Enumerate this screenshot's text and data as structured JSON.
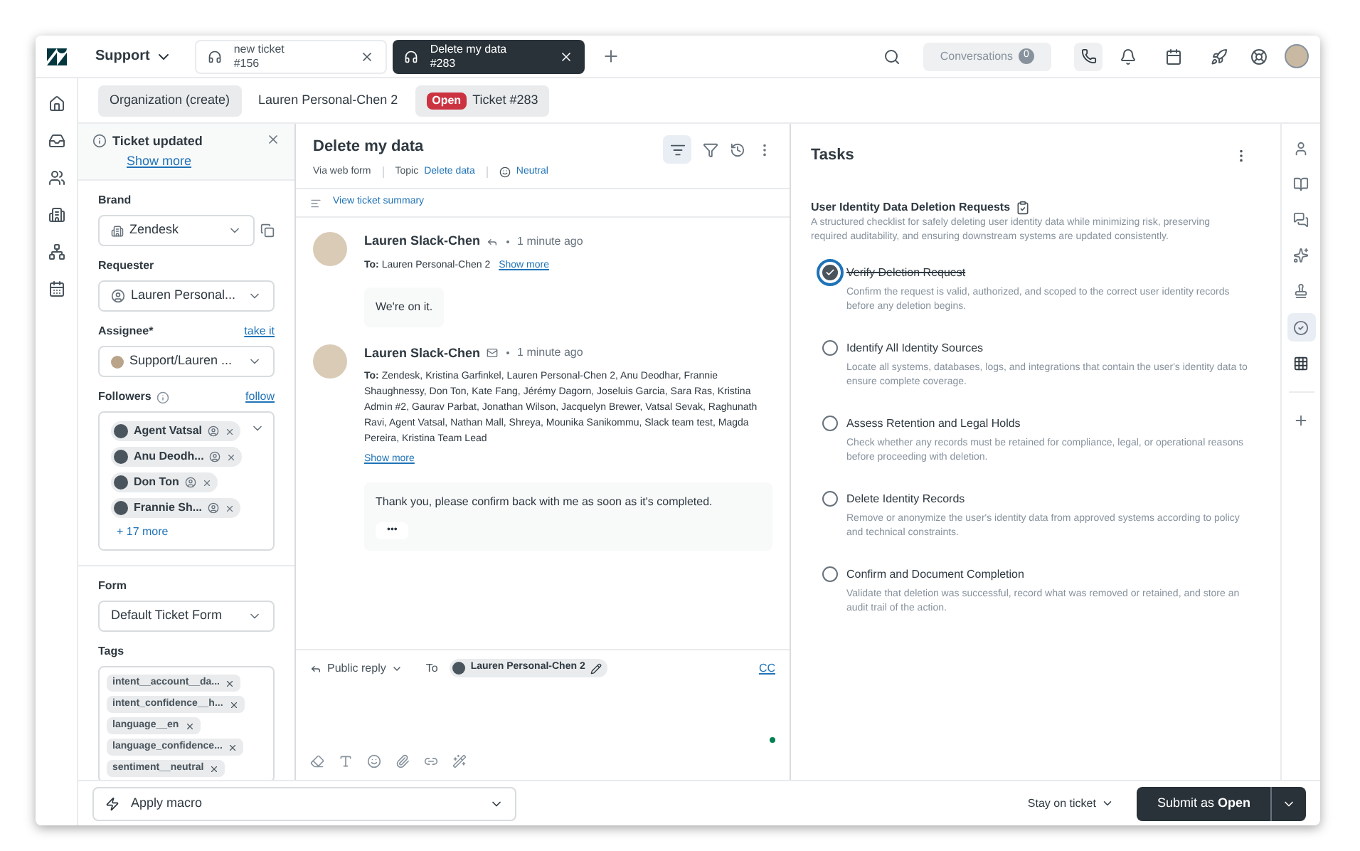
{
  "topbar": {
    "workspace": "Support",
    "tabs": [
      {
        "title": "new ticket",
        "subtitle": "#156",
        "selected": false
      },
      {
        "title": "Delete my data",
        "subtitle": "#283",
        "selected": true
      }
    ],
    "conversations": {
      "label": "Conversations",
      "count": "0"
    }
  },
  "breadcrumbs": [
    {
      "kind": "plain",
      "label": "Organization (create)",
      "selected": true
    },
    {
      "kind": "plain",
      "label": "Lauren Personal-Chen 2",
      "selected": false
    },
    {
      "kind": "status",
      "badge": "Open",
      "label": "Ticket #283",
      "selected": true
    }
  ],
  "properties": {
    "notice": {
      "title": "Ticket updated",
      "link": "Show more"
    },
    "brand": {
      "label": "Brand",
      "value": "Zendesk"
    },
    "requester": {
      "label": "Requester",
      "value": "Lauren Personal..."
    },
    "assignee": {
      "label": "Assignee*",
      "action": "take it",
      "value": "Support/Lauren ..."
    },
    "followers": {
      "label": "Followers",
      "action": "follow",
      "items": [
        "Agent Vatsal",
        "Anu Deodh...",
        "Don Ton",
        "Frannie Sh..."
      ],
      "more": "+ 17 more"
    },
    "form": {
      "label": "Form",
      "value": "Default Ticket Form"
    },
    "tags": {
      "label": "Tags",
      "items": [
        "intent__account__da...",
        "intent_confidence__h...",
        "language__en",
        "language_confidence...",
        "sentiment__neutral"
      ]
    }
  },
  "conversation": {
    "title": "Delete my data",
    "channel": "Via web form",
    "topic_label": "Topic",
    "topic": "Delete data",
    "sentiment": "Neutral",
    "summary_link": "View ticket summary",
    "messages": [
      {
        "kind": "reply",
        "author": "Lauren Slack-Chen",
        "time": "1 minute ago",
        "to_label": "To:",
        "to": "Lauren Personal-Chen 2",
        "show_more": "Show more",
        "body": "We're on it."
      },
      {
        "kind": "email",
        "author": "Lauren Slack-Chen",
        "time": "1 minute ago",
        "to_label": "To:",
        "to": "Zendesk, Kristina Garfinkel, Lauren Personal-Chen 2, Anu Deodhar, Frannie Shaughnessy, Don Ton, Kate Fang, Jérémy Dagorn, Joseluis Garcia, Sara Ras, Kristina Admin #2, Gaurav Parbat, Jonathan Wilson, Jacquelyn Brewer, Vatsal Sevak, Raghunath Ravi, Agent Vatsal, Nathan Mall, Shreya, Mounika Sanikommu, Slack team test, Magda Pereira, Kristina Team Lead",
        "show_more": "Show more",
        "body": "Thank you, please confirm back with me as soon as it's completed.",
        "ellipsis": "•••"
      }
    ],
    "composer": {
      "mode": "Public reply",
      "to_label": "To",
      "recipient": "Lauren Personal-Chen 2",
      "cc": "CC"
    }
  },
  "tasks": {
    "title": "Tasks",
    "list_title": "User Identity Data Deletion Requests",
    "description": "A structured checklist for safely deleting user identity data while minimizing risk, preserving required auditability, and ensuring downstream systems are updated consistently.",
    "items": [
      {
        "title": "Verify Deletion Request",
        "description": "Confirm the request is valid, authorized, and scoped to the correct user identity records before any deletion begins.",
        "checked": true
      },
      {
        "title": "Identify All Identity Sources",
        "description": "Locate all systems, databases, logs, and integrations that contain the user's identity data to ensure complete coverage.",
        "checked": false
      },
      {
        "title": "Assess Retention and Legal Holds",
        "description": "Check whether any records must be retained for compliance, legal, or operational reasons before proceeding with deletion.",
        "checked": false
      },
      {
        "title": "Delete Identity Records",
        "description": "Remove or anonymize the user's identity data from approved systems according to policy and technical constraints.",
        "checked": false
      },
      {
        "title": "Confirm and Document Completion",
        "description": "Validate that deletion was successful, record what was removed or retained, and store an audit trail of the action.",
        "checked": false
      }
    ]
  },
  "footer": {
    "macro": "Apply macro",
    "stay": "Stay on ticket",
    "submit": "Submit as",
    "submit_status": "Open"
  }
}
